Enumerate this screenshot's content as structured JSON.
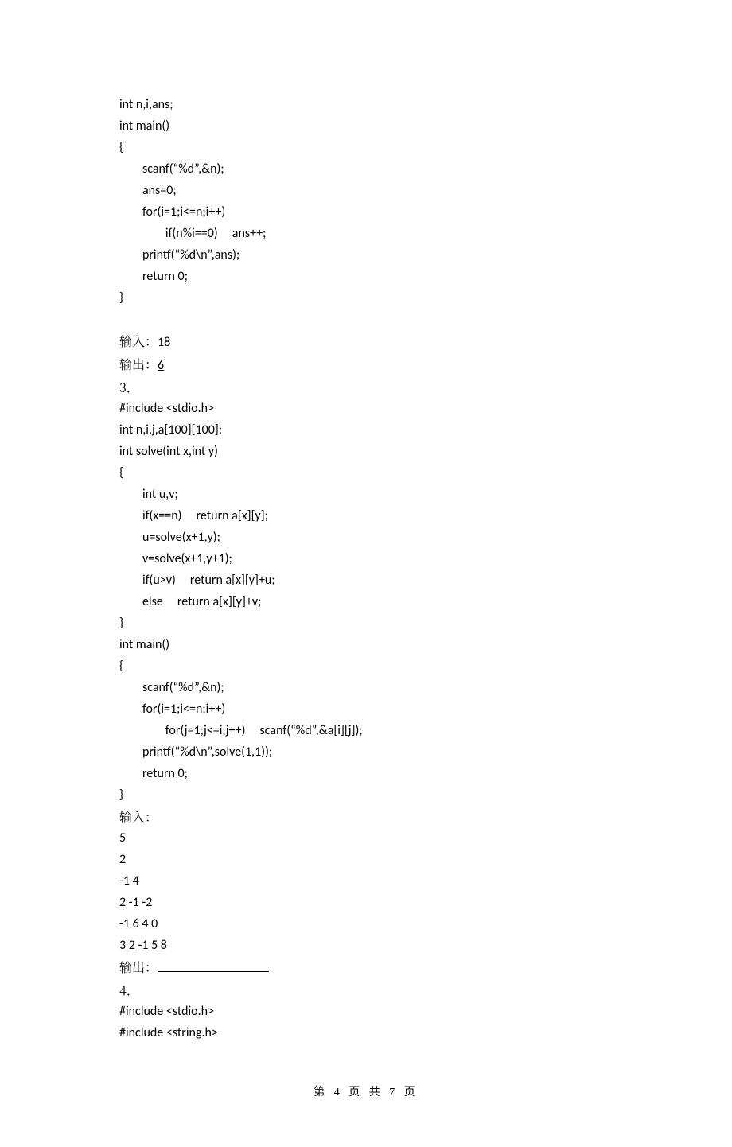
{
  "code1": {
    "l1": "int n,i,ans;",
    "l2": "int main()",
    "l3": "{",
    "l4": "        scanf(“%d”,&n);",
    "l5": "        ans=0;",
    "l6": "        for(i=1;i<=n;i++)",
    "l7": "                if(n%i==0)     ans++;",
    "l8": "        printf(“%d\\n”,ans);",
    "l9": "        return 0;",
    "l10": "}"
  },
  "io1": {
    "input_label": "输入：",
    "input_val": "18",
    "output_label": "输出：",
    "output_val": "6"
  },
  "q3": "3．",
  "code2": {
    "l1": "#include <stdio.h>",
    "l2": "int n,i,j,a[100][100];",
    "l3": "int solve(int x,int y)",
    "l4": "{",
    "l5": "        int u,v;",
    "l6": "        if(x==n)     return a[x][y];",
    "l7": "        u=solve(x+1,y);",
    "l8": "        v=solve(x+1,y+1);",
    "l9": "        if(u>v)     return a[x][y]+u;",
    "l10": "        else     return a[x][y]+v;",
    "l11": "}",
    "l12": "int main()",
    "l13": "{",
    "l14": "        scanf(“%d”,&n);",
    "l15": "        for(i=1;i<=n;i++)",
    "l16": "                for(j=1;j<=i;j++)     scanf(“%d”,&a[i][j]);",
    "l17": "        printf(“%d\\n”,solve(1,1));",
    "l18": "        return 0;",
    "l19": "}"
  },
  "io2": {
    "input_label": "输入：",
    "d1": "5",
    "d2": "2",
    "d3": "-1 4",
    "d4": "2 -1 -2",
    "d5": "-1 6 4 0",
    "d6": "3 2 -1 5 8",
    "output_label": "输出："
  },
  "q4": "4．",
  "code3": {
    "l1": "#include <stdio.h>",
    "l2": "#include <string.h>"
  },
  "footer": {
    "a": "第 ",
    "pg": "4",
    "b": " 页 共 ",
    "total": "7",
    "c": " 页"
  }
}
